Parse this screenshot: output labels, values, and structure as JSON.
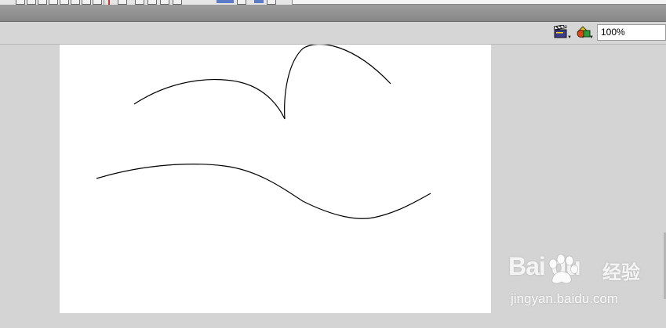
{
  "edit_bar": {
    "scene_icon": "clapperboard-icon",
    "symbol_icon": "symbol-shapes-icon",
    "zoom_value": "100%"
  },
  "stage": {
    "background": "#ffffff",
    "stroke_color": "#000000"
  },
  "watermark": {
    "logo": "Bai du",
    "cn_text": "经验",
    "url": "jingyan.baidu.com"
  }
}
